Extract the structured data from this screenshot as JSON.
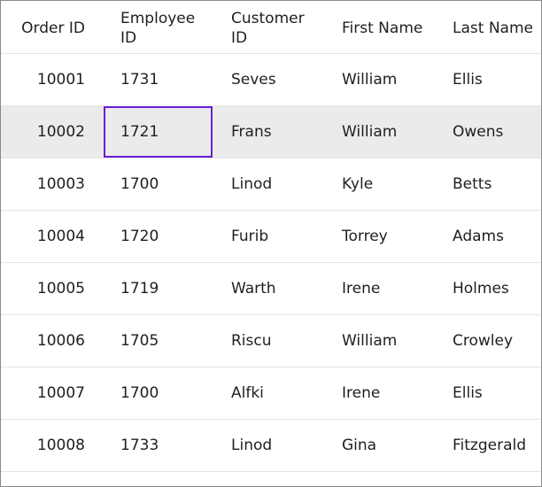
{
  "columns": [
    "Order ID",
    "Employee ID",
    "Customer ID",
    "First Name",
    "Last Name"
  ],
  "rows": [
    {
      "order_id": "10001",
      "employee_id": "1731",
      "customer_id": "Seves",
      "first_name": "William",
      "last_name": "Ellis"
    },
    {
      "order_id": "10002",
      "employee_id": "1721",
      "customer_id": "Frans",
      "first_name": "William",
      "last_name": "Owens"
    },
    {
      "order_id": "10003",
      "employee_id": "1700",
      "customer_id": "Linod",
      "first_name": "Kyle",
      "last_name": "Betts"
    },
    {
      "order_id": "10004",
      "employee_id": "1720",
      "customer_id": "Furib",
      "first_name": "Torrey",
      "last_name": "Adams"
    },
    {
      "order_id": "10005",
      "employee_id": "1719",
      "customer_id": "Warth",
      "first_name": "Irene",
      "last_name": "Holmes"
    },
    {
      "order_id": "10006",
      "employee_id": "1705",
      "customer_id": "Riscu",
      "first_name": "William",
      "last_name": "Crowley"
    },
    {
      "order_id": "10007",
      "employee_id": "1700",
      "customer_id": "Alfki",
      "first_name": "Irene",
      "last_name": "Ellis"
    },
    {
      "order_id": "10008",
      "employee_id": "1733",
      "customer_id": "Linod",
      "first_name": "Gina",
      "last_name": "Fitzgerald"
    }
  ],
  "selected_row_index": 1,
  "focused_cell": {
    "row": 1,
    "column": "employee_id"
  },
  "colors": {
    "selected_row_background": "#ebebeb",
    "focus_border": "#6a1fd6",
    "grid_border": "#8a8a8a",
    "row_divider": "#e6e6e6",
    "text": "#1f1f1f"
  }
}
